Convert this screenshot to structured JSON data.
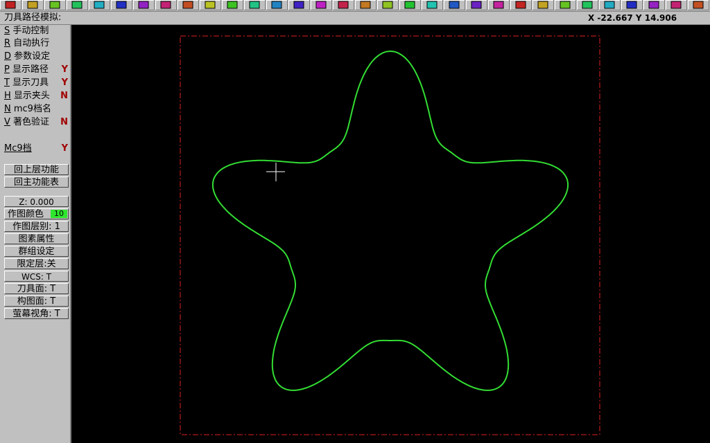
{
  "title": "刀具路径模拟:",
  "coords": "X -22.667  Y 14.906",
  "toolbar_icons": [
    "arrow-left-icon",
    "arrow-right-icon",
    "info-icon",
    "save-icon",
    "zoom-window-icon",
    "zoom-in-icon",
    "zoom-out-icon",
    "zoom-previous-icon",
    "pan-icon",
    "fit-icon",
    "repaint-icon",
    "cube-top-icon",
    "cube-front-icon",
    "cube-side-icon",
    "cube-iso-icon",
    "cube-view5-icon",
    "cube-view6-icon",
    "cube-view7-icon",
    "cube-view8-icon",
    "pencil-icon",
    "delete-icon",
    "move-icon",
    "copy-icon",
    "check-icon",
    "sphere-icon",
    "layer-icon",
    "sigma-icon",
    "line-icon",
    "dot-icon",
    "cross-icon",
    "arc-icon",
    "box-icon"
  ],
  "menu": [
    {
      "key": "S",
      "label": "手动控制",
      "flag": ""
    },
    {
      "key": "R",
      "label": "自动执行",
      "flag": ""
    },
    {
      "key": "D",
      "label": "参数设定",
      "flag": ""
    },
    {
      "key": "P",
      "label": "显示路径",
      "flag": "Y"
    },
    {
      "key": "T",
      "label": "显示刀具",
      "flag": "Y"
    },
    {
      "key": "H",
      "label": "显示夹头",
      "flag": "N"
    },
    {
      "key": "N",
      "label": "mc9档名",
      "flag": ""
    },
    {
      "key": "V",
      "label": "著色验证",
      "flag": "N"
    }
  ],
  "mc9": {
    "key": "Mc9档",
    "flag": "Y"
  },
  "nav_buttons": [
    "回上层功能",
    "回主功能表"
  ],
  "settings": {
    "z": "Z:   0.000",
    "color_label": "作图颜色",
    "color_value": "10",
    "color_hex": "#2ee62e",
    "level": "作图层别:  1",
    "attributes": "图素属性",
    "group": "群组设定",
    "mask": "限定层:关",
    "wcs": "WCS:   T",
    "tplane": "刀具面:  T",
    "cplane": "构图面:  T",
    "gview": "萤幕视角:  T"
  },
  "colors": {
    "toolpath": "#33dd33",
    "boundary": "#e02020",
    "crosshair": "#ffffff",
    "background": "#000000"
  }
}
